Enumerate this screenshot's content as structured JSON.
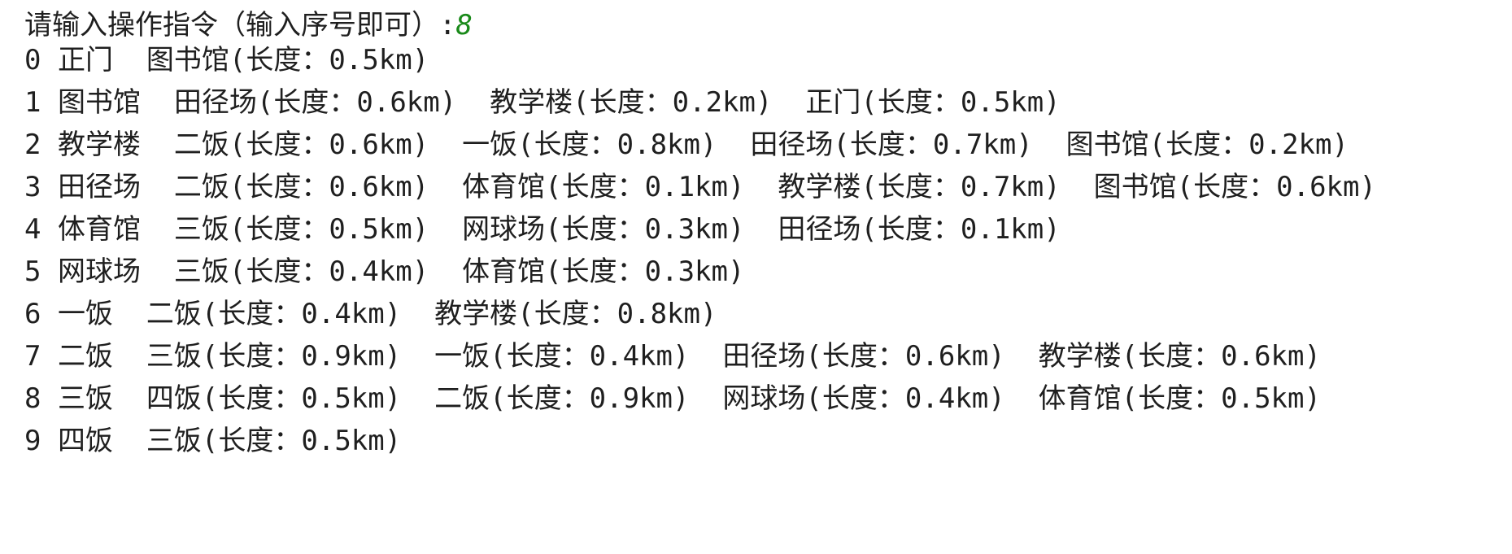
{
  "console": {
    "prompt": "请输入操作指令（输入序号即可）:",
    "user_input": "8",
    "lines": [
      {
        "index": "0",
        "node": "正门",
        "edges": [
          "图书馆(长度：0.5km)"
        ]
      },
      {
        "index": "1",
        "node": "图书馆",
        "edges": [
          "田径场(长度：0.6km)",
          "教学楼(长度：0.2km)",
          "正门(长度：0.5km)"
        ]
      },
      {
        "index": "2",
        "node": "教学楼",
        "edges": [
          "二饭(长度：0.6km)",
          "一饭(长度：0.8km)",
          "田径场(长度：0.7km)",
          "图书馆(长度：0.2km)"
        ]
      },
      {
        "index": "3",
        "node": "田径场",
        "edges": [
          "二饭(长度：0.6km)",
          "体育馆(长度：0.1km)",
          "教学楼(长度：0.7km)",
          "图书馆(长度：0.6km)"
        ]
      },
      {
        "index": "4",
        "node": "体育馆",
        "edges": [
          "三饭(长度：0.5km)",
          "网球场(长度：0.3km)",
          "田径场(长度：0.1km)"
        ]
      },
      {
        "index": "5",
        "node": "网球场",
        "edges": [
          "三饭(长度：0.4km)",
          "体育馆(长度：0.3km)"
        ]
      },
      {
        "index": "6",
        "node": "一饭",
        "edges": [
          "二饭(长度：0.4km)",
          "教学楼(长度：0.8km)"
        ]
      },
      {
        "index": "7",
        "node": "二饭",
        "edges": [
          "三饭(长度：0.9km)",
          "一饭(长度：0.4km)",
          "田径场(长度：0.6km)",
          "教学楼(长度：0.6km)"
        ]
      },
      {
        "index": "8",
        "node": "三饭",
        "edges": [
          "四饭(长度：0.5km)",
          "二饭(长度：0.9km)",
          "网球场(长度：0.4km)",
          "体育馆(长度：0.5km)"
        ]
      },
      {
        "index": "9",
        "node": "四饭",
        "edges": [
          "三饭(长度：0.5km)"
        ]
      }
    ]
  }
}
